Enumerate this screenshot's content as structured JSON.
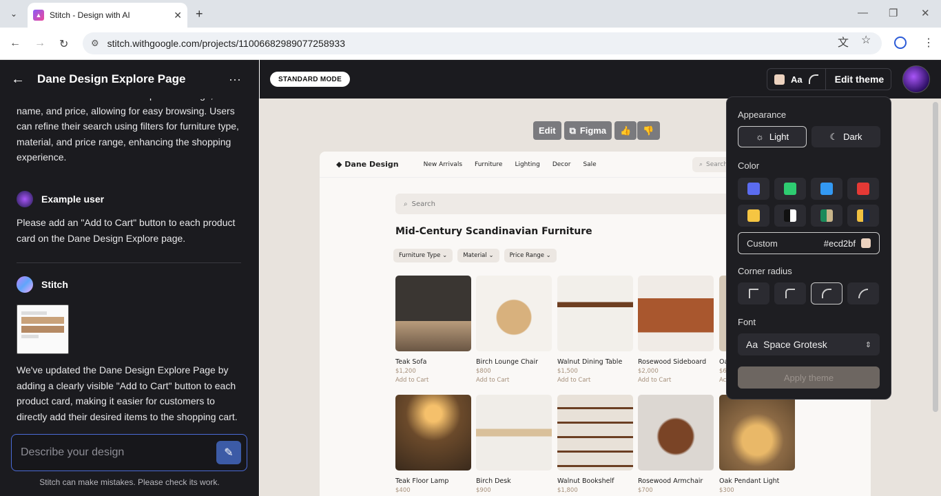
{
  "browser": {
    "tab_title": "Stitch - Design with AI",
    "url": "stitch.withgoogle.com/projects/11006682989077258933"
  },
  "sidebar": {
    "title": "Dane Design Explore Page",
    "intro": "item is showcased with a clear product image, its name, and price, allowing for easy browsing. Users can refine their search using filters for furniture type, material, and price range, enhancing the shopping experience.",
    "user_name": "Example user",
    "user_msg": "Please add an \"Add to Cart\" button to each product card on the Dane Design Explore page.",
    "bot_name": "Stitch",
    "bot_msg": "We've updated the Dane Design Explore Page by adding a clearly visible \"Add to Cart\" button to each product card, making it easier for customers to directly add their desired items to the shopping cart.",
    "composer_placeholder": "Describe your design",
    "footer": "Stitch can make mistakes. Please check its work."
  },
  "header": {
    "mode": "STANDARD MODE",
    "aa": "Aa",
    "edit_theme": "Edit theme"
  },
  "toolbar": {
    "edit": "Edit",
    "figma": "Figma"
  },
  "preview": {
    "brand": "Dane Design",
    "nav": [
      "New Arrivals",
      "Furniture",
      "Lighting",
      "Decor",
      "Sale"
    ],
    "top_search": "Search",
    "search": "Search",
    "heading": "Mid-Century Scandinavian Furniture",
    "filters": [
      "Furniture Type",
      "Material",
      "Price Range"
    ],
    "products": [
      {
        "name": "Teak Sofa",
        "price": "$1,200",
        "cta": "Add to Cart",
        "color": "#4a4036"
      },
      {
        "name": "Birch Lounge Chair",
        "price": "$800",
        "cta": "Add to Cart",
        "color": "#d9c3a0"
      },
      {
        "name": "Walnut Dining Table",
        "price": "$1,500",
        "cta": "Add to Cart",
        "color": "#e8e2da"
      },
      {
        "name": "Rosewood Sideboard",
        "price": "$2,000",
        "cta": "Add to Cart",
        "color": "#c1794a"
      },
      {
        "name": "Teak Floor Lamp",
        "price": "$400",
        "cta": "",
        "color": "#7b5a3a"
      },
      {
        "name": "Birch Desk",
        "price": "$900",
        "cta": "",
        "color": "#e9e3db"
      },
      {
        "name": "Walnut Bookshelf",
        "price": "$1,800",
        "cta": "",
        "color": "#c9b8a6"
      },
      {
        "name": "Rosewood Armchair",
        "price": "$700",
        "cta": "",
        "color": "#a67957"
      },
      {
        "name": "Oak Pendant Light",
        "price": "$300",
        "cta": "",
        "color": "#8c6a45"
      }
    ],
    "partial": {
      "name": "Oa",
      "price": "$6",
      "cta": "Ac"
    }
  },
  "theme_panel": {
    "appearance": "Appearance",
    "light": "Light",
    "dark": "Dark",
    "color": "Color",
    "custom": "Custom",
    "custom_hex": "#ecd2bf",
    "corner": "Corner radius",
    "font": "Font",
    "font_value": "Space Grotesk",
    "font_prefix": "Aa",
    "apply": "Apply theme",
    "swatches": [
      "#5b6cf0",
      "#2ecc71",
      "#3399f3",
      "#e53935",
      "#f5c542",
      "#111111",
      "#1b8a5a",
      "#f0c040"
    ]
  }
}
